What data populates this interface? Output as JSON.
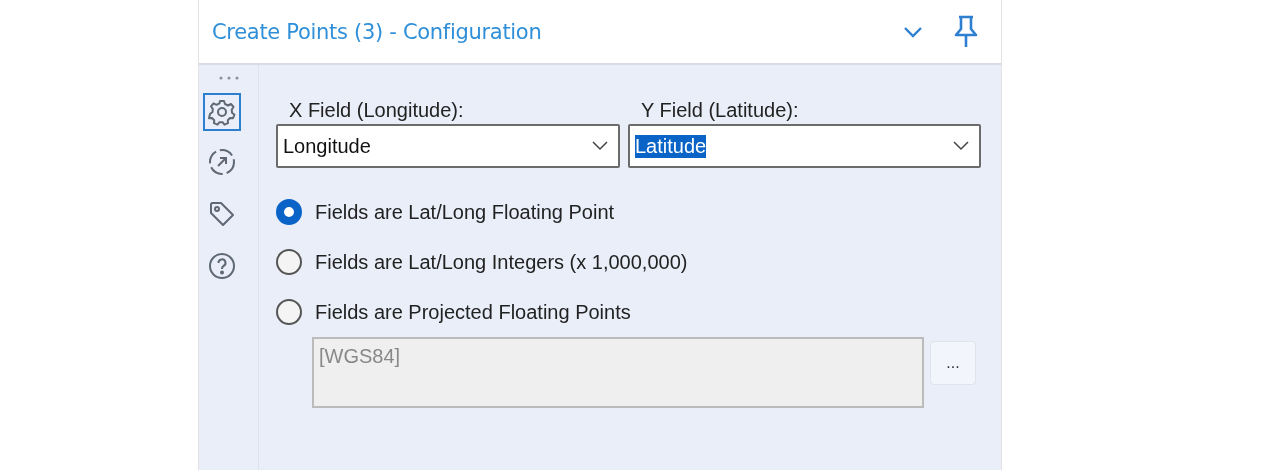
{
  "panel": {
    "title": "Create Points (3) - Configuration"
  },
  "sidebar": {
    "items": [
      {
        "kind": "settings",
        "selected": true
      },
      {
        "kind": "connection",
        "selected": false
      },
      {
        "kind": "tag",
        "selected": false
      },
      {
        "kind": "help",
        "selected": false
      }
    ]
  },
  "fields": [
    {
      "label": "X Field (Longitude):",
      "value": "Longitude",
      "text_selected": false
    },
    {
      "label": "Y Field (Latitude):",
      "value": "Latitude",
      "text_selected": true
    }
  ],
  "options": [
    {
      "label": "Fields are Lat/Long Floating Point",
      "selected": true
    },
    {
      "label": "Fields are Lat/Long Integers (x 1,000,000)",
      "selected": false
    },
    {
      "label": "Fields are Projected Floating Points",
      "selected": false
    }
  ],
  "projection": {
    "value": "[WGS84]",
    "disabled": true,
    "button": "..."
  }
}
